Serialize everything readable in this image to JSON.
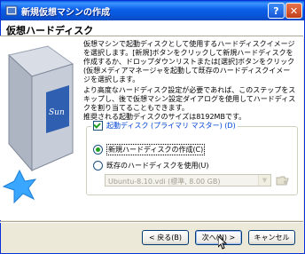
{
  "window": {
    "title": "新規仮想マシンの作成",
    "help_glyph": "?",
    "close_glyph": "✕"
  },
  "page": {
    "title": "仮想ハードディスク"
  },
  "description": {
    "p1": "仮想マシンで起動ディスクとして使用するハードディスクイメージを選択します。[新規]ボタンをクリックして新規ハードディスクを作成するか、ドロップダウンリストまたは[選択]ボタンをクリック(仮想メディアマネージャを起動して既存のハードディスクイメージを選択します。",
    "p2": "より高度なハードディスク設定が必要であれば、このステップをスキップし、後で仮想マシン設定ダイアログを使用してハードディスクを割り当てることもできます。",
    "p3": "推奨される起動ディスクのサイズは8192MBです。"
  },
  "boot_disk": {
    "label": "起動ディスク (プライマリ マスター) (D)",
    "checked": true
  },
  "options": [
    {
      "label": "新規ハードディスクの作成(C)",
      "selected": true
    },
    {
      "label": "既存のハードディスクを使用(U)",
      "selected": false
    }
  ],
  "existing_disk": {
    "value": "Ubuntu-8.10.vdi (標準, 8.00 GB)"
  },
  "buttons": {
    "back": "< 戻る(B)",
    "next": "次へ(N) >",
    "cancel": "キャンセル"
  },
  "icons": {
    "app": "virtualbox-icon",
    "folder": "folder-open-icon",
    "cursor": "mouse-pointer-icon"
  },
  "colors": {
    "titlebar": "#0a5ee8",
    "accent_link": "#0046d5",
    "check": "#21a121"
  }
}
